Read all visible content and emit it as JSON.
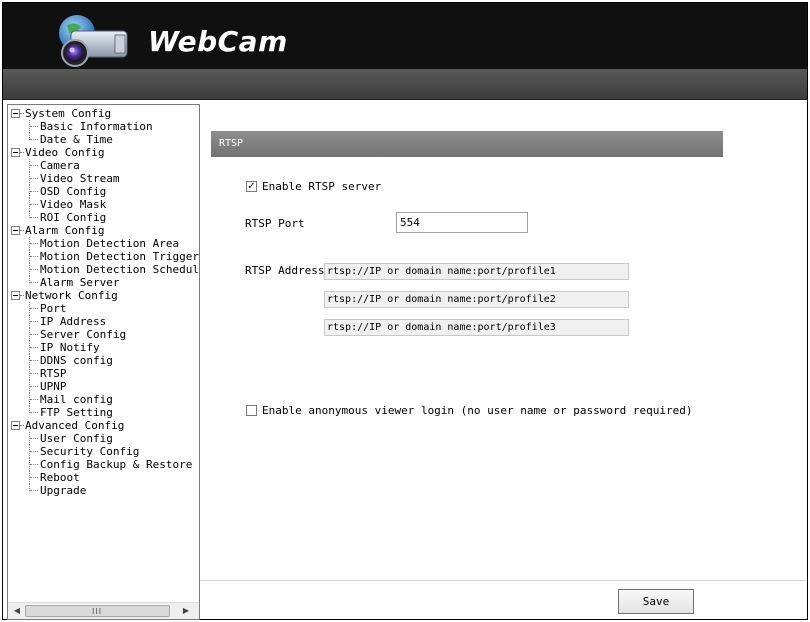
{
  "header": {
    "logo_text": "WebCam"
  },
  "sidebar": {
    "tree": [
      {
        "type": "group",
        "label": "System Config"
      },
      {
        "type": "child",
        "label": "Basic Information"
      },
      {
        "type": "child",
        "label": "Date & Time",
        "last": true
      },
      {
        "type": "group",
        "label": "Video Config"
      },
      {
        "type": "child",
        "label": "Camera"
      },
      {
        "type": "child",
        "label": "Video Stream"
      },
      {
        "type": "child",
        "label": "OSD Config"
      },
      {
        "type": "child",
        "label": "Video Mask"
      },
      {
        "type": "child",
        "label": "ROI Config",
        "last": true
      },
      {
        "type": "group",
        "label": "Alarm Config"
      },
      {
        "type": "child",
        "label": "Motion Detection Area"
      },
      {
        "type": "child",
        "label": "Motion Detection Trigger"
      },
      {
        "type": "child",
        "label": "Motion Detection Schedul"
      },
      {
        "type": "child",
        "label": "Alarm Server",
        "last": true
      },
      {
        "type": "group",
        "label": "Network Config"
      },
      {
        "type": "child",
        "label": "Port"
      },
      {
        "type": "child",
        "label": "IP Address"
      },
      {
        "type": "child",
        "label": "Server Config"
      },
      {
        "type": "child",
        "label": "IP Notify"
      },
      {
        "type": "child",
        "label": "DDNS config"
      },
      {
        "type": "child",
        "label": "RTSP"
      },
      {
        "type": "child",
        "label": "UPNP"
      },
      {
        "type": "child",
        "label": "Mail config"
      },
      {
        "type": "child",
        "label": "FTP Setting",
        "last": true
      },
      {
        "type": "group",
        "label": "Advanced Config"
      },
      {
        "type": "child",
        "label": "User Config"
      },
      {
        "type": "child",
        "label": "Security Config"
      },
      {
        "type": "child",
        "label": "Config Backup & Restore"
      },
      {
        "type": "child",
        "label": "Reboot"
      },
      {
        "type": "child",
        "label": "Upgrade",
        "last": true
      }
    ],
    "scroll_grip": "III"
  },
  "main": {
    "section_title": "RTSP",
    "enable_rtsp": {
      "label": "Enable RTSP server",
      "checked": true
    },
    "rtsp_port": {
      "label": "RTSP Port",
      "value": "554"
    },
    "rtsp_address": {
      "label": "RTSP Address",
      "values": [
        "rtsp://IP or domain name:port/profile1",
        "rtsp://IP or domain name:port/profile2",
        "rtsp://IP or domain name:port/profile3"
      ]
    },
    "anonymous_login": {
      "label": "Enable anonymous viewer login (no user name or password required)",
      "checked": false
    },
    "save_label": "Save"
  },
  "colors": {
    "header_bg": "#101010",
    "subbar_bg": "#4a4a4a",
    "section_bar_bg": "#808080"
  }
}
